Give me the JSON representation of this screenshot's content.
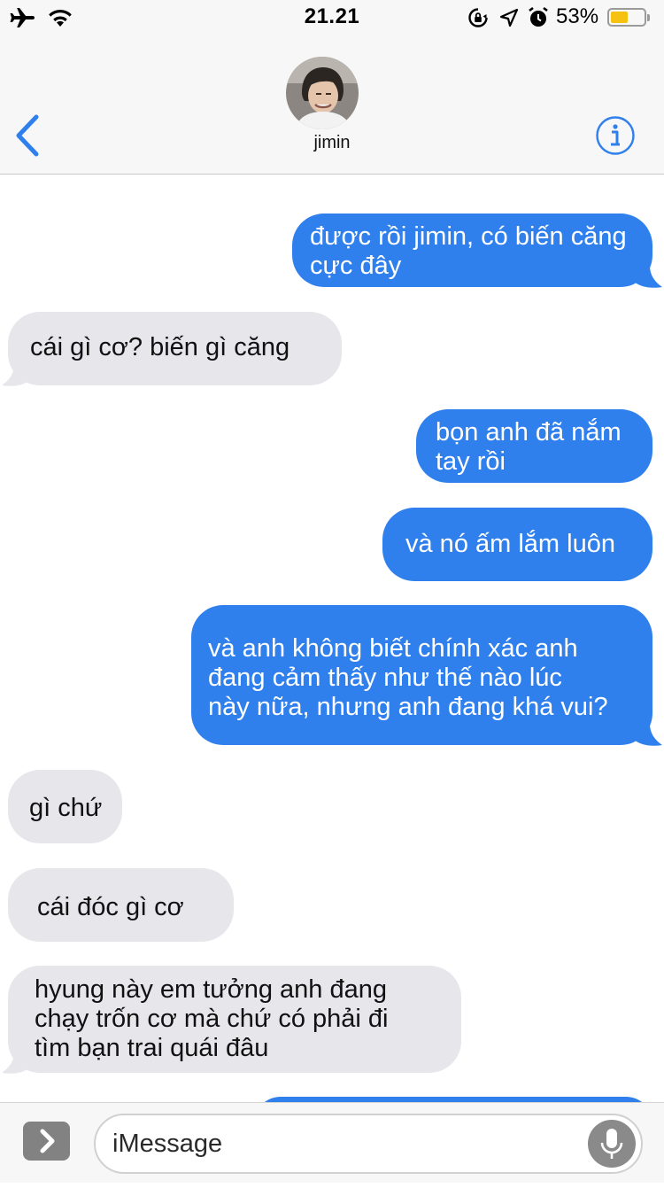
{
  "status_bar": {
    "time": "21.21",
    "battery_percent": "53%",
    "battery_level": 0.53,
    "icons": [
      "airplane-icon",
      "wifi-icon",
      "orientation-lock-icon",
      "location-icon",
      "alarm-icon",
      "battery-icon"
    ]
  },
  "header": {
    "contact_name": "jimin",
    "back_icon": "chevron-left-icon",
    "info_icon": "info-icon",
    "accent_color": "#2f80ed"
  },
  "messages": [
    {
      "direction": "sent",
      "lines": [
        "được rồi jimin, có biến căng",
        "cực đây"
      ]
    },
    {
      "direction": "received",
      "lines": [
        "cái gì cơ? biến gì căng"
      ]
    },
    {
      "direction": "sent",
      "lines": [
        "bọn anh đã nắm",
        "tay rồi"
      ]
    },
    {
      "direction": "sent",
      "lines": [
        "và nó ấm lắm luôn"
      ]
    },
    {
      "direction": "sent",
      "lines": [
        "và anh không biết chính xác anh",
        "đang cảm thấy như thế nào lúc",
        "này nữa, nhưng anh đang khá vui?"
      ]
    },
    {
      "direction": "received",
      "lines": [
        "gì chứ"
      ]
    },
    {
      "direction": "received",
      "lines": [
        "cái đóc gì cơ"
      ]
    },
    {
      "direction": "received",
      "lines": [
        "hyung này em tưởng anh đang",
        "chạy trốn cơ mà chứ có phải đi",
        "tìm bạn trai quái đâu"
      ]
    }
  ],
  "colors": {
    "sent_bubble": "#2f80ed",
    "received_bubble": "#e6e6eb"
  },
  "input": {
    "placeholder": "iMessage",
    "apps_icon": "chevron-right-icon",
    "mic_icon": "microphone-icon"
  }
}
